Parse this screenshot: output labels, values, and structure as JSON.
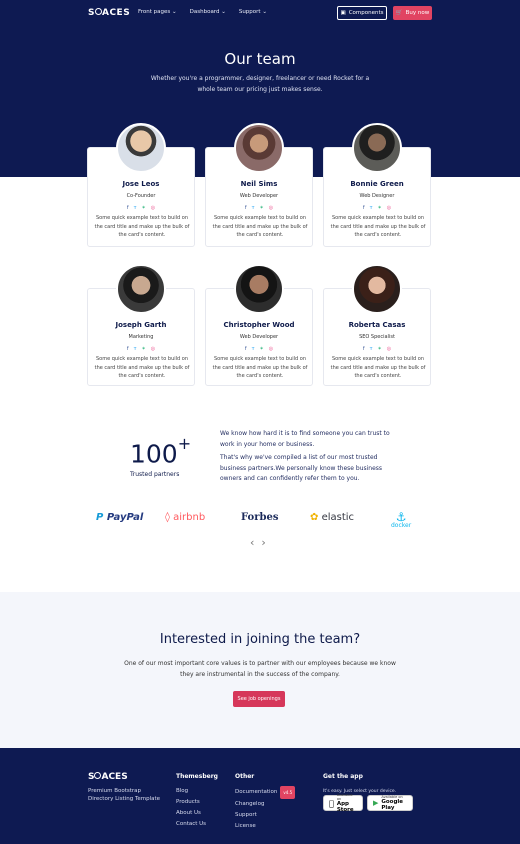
{
  "nav": {
    "logo": "SPACES",
    "menu": [
      "Front pages",
      "Dashboard",
      "Support"
    ],
    "components_label": "Components",
    "buy_label": "Buy now"
  },
  "hero": {
    "title": "Our team",
    "subtitle": "Whether you're a programmer, designer, freelancer or need Rocket for a whole team our pricing just makes sense."
  },
  "team": [
    {
      "name": "Jose Leos",
      "role": "Co-Founder",
      "desc": "Some quick example text to build on the card title and make up the bulk of the card's content."
    },
    {
      "name": "Neil Sims",
      "role": "Web Developer",
      "desc": "Some quick example text to build on the card title and make up the bulk of the card's content."
    },
    {
      "name": "Bonnie Green",
      "role": "Web Designer",
      "desc": "Some quick example text to build on the card title and make up the bulk of the card's content."
    },
    {
      "name": "Joseph Garth",
      "role": "Marketing",
      "desc": "Some quick example text to build on the card title and make up the bulk of the card's content."
    },
    {
      "name": "Christopher Wood",
      "role": "Web Developer",
      "desc": "Some quick example text to build on the card title and make up the bulk of the card's content."
    },
    {
      "name": "Roberta Casas",
      "role": "SEO Specialist",
      "desc": "Some quick example text to build on the card title and make up the bulk of the card's content."
    }
  ],
  "social_icons": [
    "facebook-icon",
    "twitter-icon",
    "slack-icon",
    "dribbble-icon"
  ],
  "colors": {
    "navy": "#0e1a52",
    "accent": "#e14462",
    "facebook": "#3b5998",
    "twitter": "#1da1f2",
    "slack": "#2eb67d",
    "dribbble": "#ea4c89"
  },
  "trusted": {
    "number": "100",
    "plus": "+",
    "label": "Trusted partners",
    "para1": "We know how hard it is to find someone you can trust to work in your home or business.",
    "para2": "That's why we've compiled a list of our most trusted business partners.We personally know these business owners and can confidently refer them to you."
  },
  "partners": [
    "PayPal",
    "airbnb",
    "Forbes",
    "elastic",
    "docker"
  ],
  "join": {
    "title": "Interested in joining the team?",
    "text": "One of our most important core values is to partner with our employees because we know they are instrumental in the success of the company.",
    "button": "See job openings"
  },
  "footer": {
    "logo": "SPACES",
    "desc": "Premium Bootstrap Directory Listing Template",
    "col1": {
      "title": "Themesberg",
      "items": [
        "Blog",
        "Products",
        "About Us",
        "Contact Us"
      ]
    },
    "col2": {
      "title": "Other",
      "items": [
        "Documentation",
        "Changelog",
        "Support",
        "License"
      ],
      "badge": "v4.5"
    },
    "app": {
      "title": "Get the app",
      "text": "It's easy. Just select your device.",
      "appstore_small": "Available on",
      "appstore": "App Store",
      "play_small": "Available on",
      "play": "Google Play"
    }
  }
}
